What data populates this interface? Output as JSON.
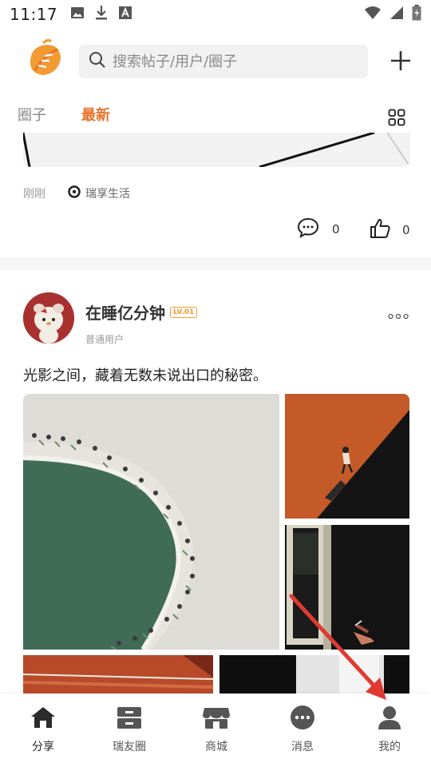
{
  "status_bar": {
    "time": "11:17"
  },
  "header": {
    "search_placeholder": "搜索帖子/用户/圈子"
  },
  "tabs": [
    {
      "label": "圈子"
    },
    {
      "label": "最新"
    }
  ],
  "first_post": {
    "time": "刚刚",
    "circle": "瑞享生活",
    "comments": "0",
    "likes": "0"
  },
  "post": {
    "username": "在睡亿分钟",
    "level": "LV.01",
    "user_type": "普通用户",
    "text": "光影之间，藏着无数未说出口的秘密。"
  },
  "bottom_nav": [
    {
      "label": "分享",
      "icon": "home-icon"
    },
    {
      "label": "瑞友圈",
      "icon": "box-icon"
    },
    {
      "label": "商城",
      "icon": "store-icon"
    },
    {
      "label": "消息",
      "icon": "chat-icon"
    },
    {
      "label": "我的",
      "icon": "person-icon"
    }
  ],
  "colors": {
    "accent": "#e8732a",
    "level_badge": "#f29a33",
    "arrow": "#e03a32"
  }
}
